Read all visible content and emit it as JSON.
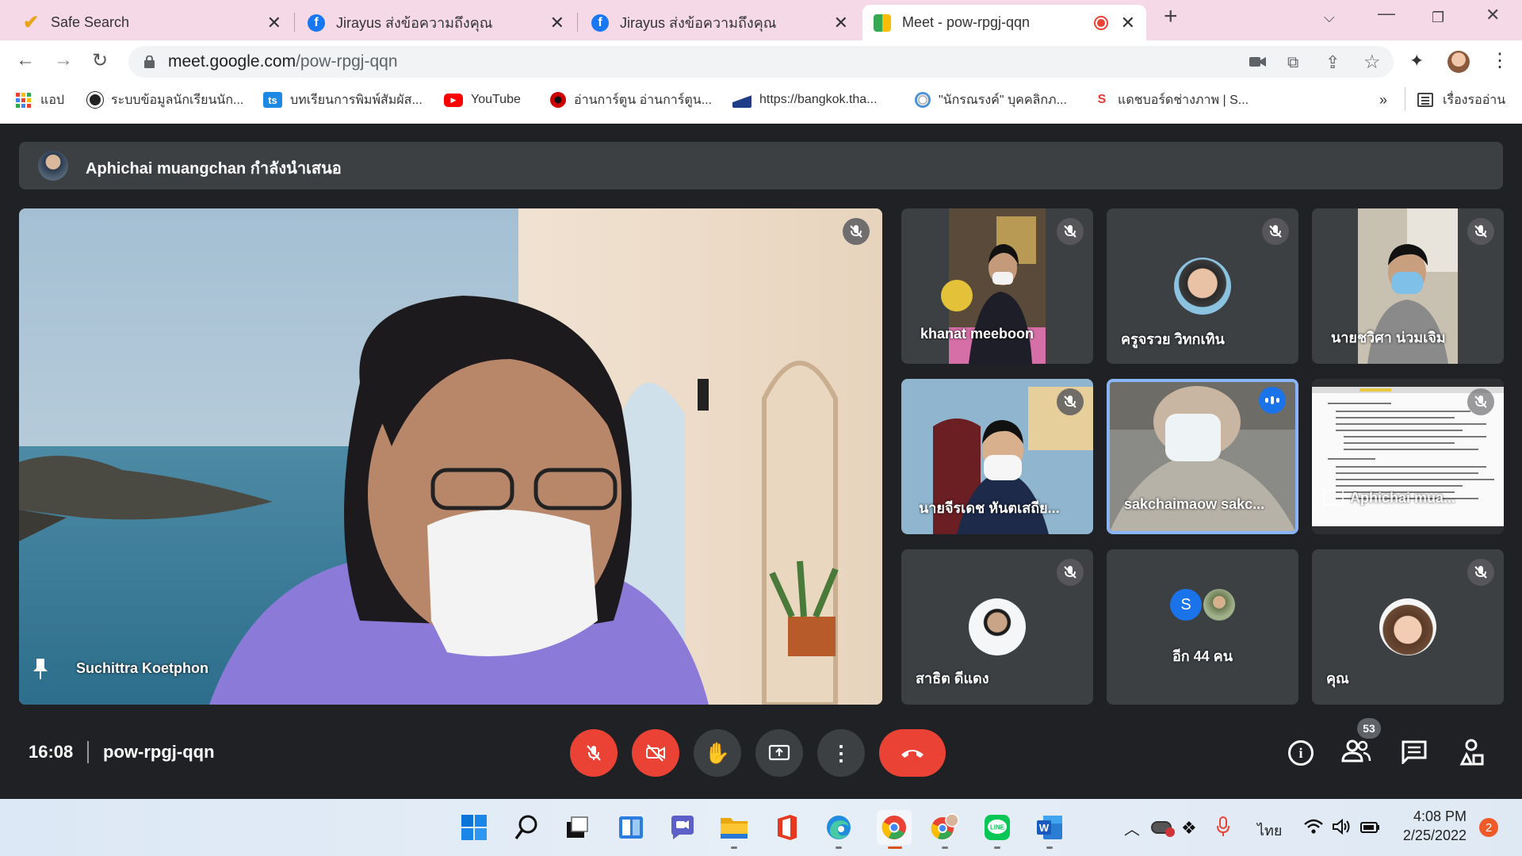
{
  "browser": {
    "tabs": [
      {
        "title": "Safe Search"
      },
      {
        "title": "Jirayus ส่งข้อความถึงคุณ"
      },
      {
        "title": "Jirayus ส่งข้อความถึงคุณ"
      },
      {
        "title": "Meet - pow-rpgj-qqn"
      }
    ],
    "url_host": "meet.google.com",
    "url_path": "/pow-rpgj-qqn",
    "bookmarks": [
      {
        "label": "แอป"
      },
      {
        "label": "ระบบข้อมูลนักเรียนนัก..."
      },
      {
        "label": "บทเรียนการพิมพ์สัมผัส..."
      },
      {
        "label": "YouTube"
      },
      {
        "label": "อ่านการ์ตูน อ่านการ์ตูน..."
      },
      {
        "label": "https://bangkok.tha..."
      },
      {
        "label": "\"นักรณรงค์\" บุคคลิกภ..."
      },
      {
        "label": "แดชบอร์ดช่างภาพ | S..."
      }
    ],
    "reading_list": "เรื่องรออ่าน",
    "more": "»"
  },
  "meet": {
    "presenting_banner": "Aphichai muangchan กำลังนำเสนอ",
    "main_speaker": "Suchittra Koetphon",
    "participants": [
      {
        "name": "khanat meeboon"
      },
      {
        "name": "ครูจรวย วิทกเทิน"
      },
      {
        "name": "นายชวิศา น่วมเจิม"
      },
      {
        "name": "นายจีรเดช หันตเสถีย..."
      },
      {
        "name": "sakchaimaow sakc..."
      },
      {
        "name": "Aphichai mua..."
      },
      {
        "name": "สาธิต ดีแดง"
      },
      {
        "name": "อีก 44 คน"
      },
      {
        "name": "คุณ"
      }
    ],
    "others_initial": "S",
    "time": "16:08",
    "meeting_code": "pow-rpgj-qqn",
    "people_count": "53"
  },
  "taskbar": {
    "language": "ไทย",
    "clock_time": "4:08 PM",
    "clock_date": "2/25/2022",
    "notification_count": "2"
  }
}
